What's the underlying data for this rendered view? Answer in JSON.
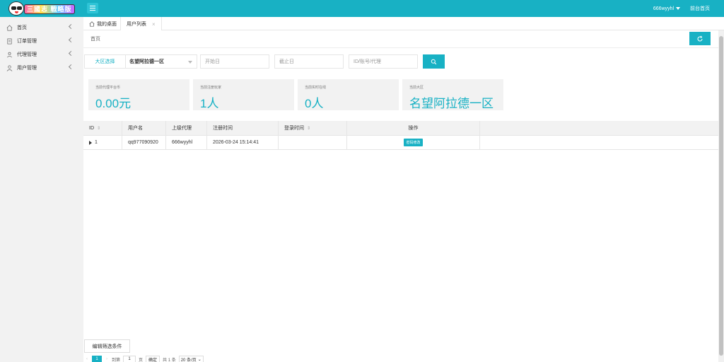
{
  "app": {
    "logo_text": "三國志 戰略版",
    "menu_icon": "hamburger-icon"
  },
  "header": {
    "username": "666wyyhl",
    "home_link": "前台首页"
  },
  "sidebar": {
    "items": [
      {
        "label": "首页",
        "icon": "home-icon"
      },
      {
        "label": "订单管理",
        "icon": "order-icon"
      },
      {
        "label": "代理管理",
        "icon": "agent-icon"
      },
      {
        "label": "用户管理",
        "icon": "user-icon"
      }
    ]
  },
  "tabs": [
    {
      "label": "我的桌面",
      "icon": "home-icon"
    },
    {
      "label": "用户列表",
      "close": "×"
    }
  ],
  "breadcrumb": "首页",
  "filters": {
    "region_label": "大区选择",
    "region_value": "名望阿拉德一区",
    "start_placeholder": "开始日",
    "end_placeholder": "截止日",
    "id_placeholder": "ID/账号/代理"
  },
  "cards": [
    {
      "label": "当前代理平台币",
      "value": "0.00元"
    },
    {
      "label": "当前注册玩家",
      "value": "1人"
    },
    {
      "label": "当前实时在线",
      "value": "0人"
    },
    {
      "label": "当前大区",
      "value": "名望阿拉德一区"
    }
  ],
  "table": {
    "headers": [
      "ID",
      "用户名",
      "上级代理",
      "注册时间",
      "登录时间",
      "操作"
    ],
    "rows": [
      {
        "id": "1",
        "username": "qq977090920",
        "agent": "666wyyhl",
        "reg_time": "2026-03-24 15:14:41",
        "login_time": "",
        "action": "密码修改"
      }
    ]
  },
  "footer": {
    "edit_filters": "编辑筛选条件",
    "pager": {
      "current_page": "1",
      "goto_label": "到第",
      "goto_value": "1",
      "page_unit": "页",
      "confirm": "确定",
      "total": "共 1 条",
      "page_size": "20 条/页"
    }
  },
  "colors": {
    "accent": "#18b1c4",
    "sidebar_bg": "#f2f2f2"
  }
}
